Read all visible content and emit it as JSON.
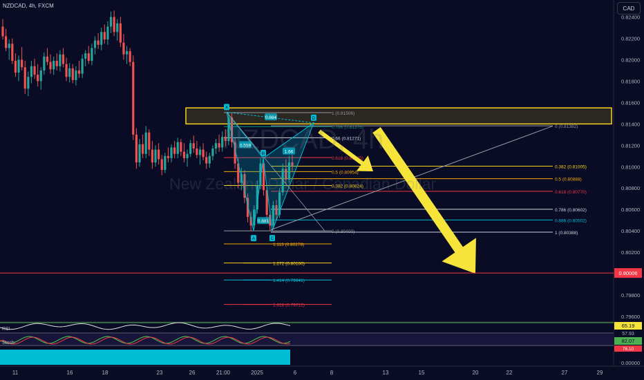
{
  "header": {
    "title": "NZDCAD, 4h, FXCM",
    "currency_button": "CAD"
  },
  "watermark": {
    "symbol": "NZDCAD, 4h",
    "description": "New Zealand Dollar / Canadian Dollar"
  },
  "colors": {
    "background": "#0a0c26",
    "up": "#26a69a",
    "down": "#ef5350",
    "zone": "#f7d21b",
    "arrow": "#f7e43a",
    "price_line": "#f23645"
  },
  "chart_data": {
    "type": "candlestick",
    "symbol": "NZDCAD",
    "interval": "4h",
    "ylim": [
      0.796,
      0.8252
    ],
    "yticks": [
      "0.82400",
      "0.82200",
      "0.82000",
      "0.81800",
      "0.81600",
      "0.81400",
      "0.81200",
      "0.81000",
      "0.80800",
      "0.80600",
      "0.80400",
      "0.80200",
      "0.80000",
      "0.79800",
      "0.79600"
    ],
    "xticks": [
      "11",
      "16",
      "18",
      "23",
      "26",
      "21:00",
      "2025",
      "6",
      "8",
      "13",
      "15",
      "20",
      "22",
      "27",
      "29"
    ],
    "current_price": {
      "value": 0.80006,
      "label": "0.80006"
    },
    "supply_zone": {
      "top": 0.8155,
      "bottom": 0.814
    },
    "fib_left": [
      {
        "ratio": "1",
        "value": 0.81506,
        "label": "1 (0.81506)",
        "color": "#9598a1"
      },
      {
        "ratio": "0.786",
        "value": 0.81375,
        "label": "0.786 (0.81375)",
        "color": "#089981"
      },
      {
        "ratio": "0.66",
        "value": 0.81271,
        "label": "0.66 (0.81271)",
        "color": "#d1d4dc"
      },
      {
        "ratio": "0.618",
        "value": 0.81085,
        "label": "0.618 (0.81085)",
        "color": "#f23645"
      },
      {
        "ratio": "0.5",
        "value": 0.80954,
        "label": "0.5 (0.80954)",
        "color": "#f7a700"
      },
      {
        "ratio": "0.382",
        "value": 0.80824,
        "label": "0.382 (0.80824)",
        "color": "#f7d21b"
      },
      {
        "ratio": "0",
        "value": 0.804,
        "label": "0 (0.80400)",
        "color": "#9598a1"
      },
      {
        "ratio": "1.113",
        "value": 0.80278,
        "label": "1.113 (0.80278)",
        "color": "#f7a700"
      },
      {
        "ratio": "1.272",
        "value": 0.801,
        "label": "1.272 (0.80100)",
        "color": "#f7d21b"
      },
      {
        "ratio": "1.414",
        "value": 0.79941,
        "label": "1.414 (0.79941)",
        "color": "#00bcd4"
      },
      {
        "ratio": "1.618",
        "value": 0.79712,
        "label": "1.618 (0.79712)",
        "color": "#f23645"
      }
    ],
    "fib_right": [
      {
        "ratio": "0",
        "value": 0.81382,
        "label": "0 (0.81382)",
        "color": "#9598a1"
      },
      {
        "ratio": "0.382",
        "value": 0.81005,
        "label": "0.382 (0.81005)",
        "color": "#f7d21b"
      },
      {
        "ratio": "0.5",
        "value": 0.80888,
        "label": "0.5 (0.80888)",
        "color": "#f7a700"
      },
      {
        "ratio": "0.618",
        "value": 0.8077,
        "label": "0.618 (0.80770)",
        "color": "#f23645"
      },
      {
        "ratio": "0.786",
        "value": 0.80602,
        "label": "0.786 (0.80602)",
        "color": "#d1d4dc"
      },
      {
        "ratio": "0.886",
        "value": 0.80502,
        "label": "0.886 (0.80502)",
        "color": "#00bcd4"
      },
      {
        "ratio": "1",
        "value": 0.80388,
        "label": "1 (0.80388)",
        "color": "#d1d4dc"
      }
    ],
    "pattern_labels": [
      "X",
      "A",
      "B",
      "C",
      "D"
    ],
    "pattern_ratios": [
      "0.884",
      "0.559",
      "1.66",
      "0.881"
    ],
    "candles": [
      {
        "o": 0.8231,
        "h": 0.8238,
        "l": 0.8219,
        "c": 0.8222
      },
      {
        "o": 0.8222,
        "h": 0.8229,
        "l": 0.8208,
        "c": 0.8211
      },
      {
        "o": 0.8211,
        "h": 0.8219,
        "l": 0.82,
        "c": 0.8215
      },
      {
        "o": 0.8215,
        "h": 0.822,
        "l": 0.8196,
        "c": 0.8199
      },
      {
        "o": 0.8199,
        "h": 0.8206,
        "l": 0.8184,
        "c": 0.8188
      },
      {
        "o": 0.8188,
        "h": 0.8204,
        "l": 0.818,
        "c": 0.82
      },
      {
        "o": 0.82,
        "h": 0.8212,
        "l": 0.819,
        "c": 0.8193
      },
      {
        "o": 0.8193,
        "h": 0.8199,
        "l": 0.8168,
        "c": 0.8173
      },
      {
        "o": 0.8173,
        "h": 0.8189,
        "l": 0.8166,
        "c": 0.8184
      },
      {
        "o": 0.8184,
        "h": 0.8199,
        "l": 0.8178,
        "c": 0.8194
      },
      {
        "o": 0.8194,
        "h": 0.8201,
        "l": 0.8182,
        "c": 0.8186
      },
      {
        "o": 0.8186,
        "h": 0.8196,
        "l": 0.8175,
        "c": 0.818
      },
      {
        "o": 0.818,
        "h": 0.8193,
        "l": 0.8172,
        "c": 0.819
      },
      {
        "o": 0.819,
        "h": 0.8207,
        "l": 0.8186,
        "c": 0.8203
      },
      {
        "o": 0.8203,
        "h": 0.8211,
        "l": 0.8195,
        "c": 0.8198
      },
      {
        "o": 0.8198,
        "h": 0.8205,
        "l": 0.8187,
        "c": 0.8191
      },
      {
        "o": 0.8191,
        "h": 0.8203,
        "l": 0.8186,
        "c": 0.8199
      },
      {
        "o": 0.8199,
        "h": 0.8206,
        "l": 0.819,
        "c": 0.8194
      },
      {
        "o": 0.8194,
        "h": 0.8209,
        "l": 0.8189,
        "c": 0.8205
      },
      {
        "o": 0.8205,
        "h": 0.8211,
        "l": 0.8193,
        "c": 0.8196
      },
      {
        "o": 0.8196,
        "h": 0.8202,
        "l": 0.818,
        "c": 0.8184
      },
      {
        "o": 0.8184,
        "h": 0.8197,
        "l": 0.8179,
        "c": 0.8192
      },
      {
        "o": 0.8192,
        "h": 0.8196,
        "l": 0.8178,
        "c": 0.8181
      },
      {
        "o": 0.8181,
        "h": 0.8194,
        "l": 0.8176,
        "c": 0.819
      },
      {
        "o": 0.819,
        "h": 0.8199,
        "l": 0.8183,
        "c": 0.8187
      },
      {
        "o": 0.8187,
        "h": 0.8205,
        "l": 0.8183,
        "c": 0.8201
      },
      {
        "o": 0.8201,
        "h": 0.8209,
        "l": 0.8194,
        "c": 0.8206
      },
      {
        "o": 0.8206,
        "h": 0.8213,
        "l": 0.8196,
        "c": 0.8199
      },
      {
        "o": 0.8199,
        "h": 0.8215,
        "l": 0.8195,
        "c": 0.8211
      },
      {
        "o": 0.8211,
        "h": 0.8222,
        "l": 0.8205,
        "c": 0.8218
      },
      {
        "o": 0.8218,
        "h": 0.8225,
        "l": 0.821,
        "c": 0.8214
      },
      {
        "o": 0.8214,
        "h": 0.823,
        "l": 0.8209,
        "c": 0.8226
      },
      {
        "o": 0.8226,
        "h": 0.8233,
        "l": 0.8215,
        "c": 0.8219
      },
      {
        "o": 0.8219,
        "h": 0.8236,
        "l": 0.8214,
        "c": 0.8231
      },
      {
        "o": 0.8231,
        "h": 0.8245,
        "l": 0.8225,
        "c": 0.824
      },
      {
        "o": 0.824,
        "h": 0.8246,
        "l": 0.8222,
        "c": 0.8226
      },
      {
        "o": 0.8226,
        "h": 0.8238,
        "l": 0.8218,
        "c": 0.8234
      },
      {
        "o": 0.8234,
        "h": 0.824,
        "l": 0.8212,
        "c": 0.8216
      },
      {
        "o": 0.8216,
        "h": 0.8224,
        "l": 0.82,
        "c": 0.8205
      },
      {
        "o": 0.8205,
        "h": 0.8213,
        "l": 0.8196,
        "c": 0.8208
      },
      {
        "o": 0.8208,
        "h": 0.8211,
        "l": 0.8194,
        "c": 0.8198
      },
      {
        "o": 0.8198,
        "h": 0.8204,
        "l": 0.8125,
        "c": 0.813
      },
      {
        "o": 0.813,
        "h": 0.8136,
        "l": 0.8098,
        "c": 0.8104
      },
      {
        "o": 0.8104,
        "h": 0.8126,
        "l": 0.81,
        "c": 0.8121
      },
      {
        "o": 0.8121,
        "h": 0.813,
        "l": 0.8108,
        "c": 0.8112
      },
      {
        "o": 0.8112,
        "h": 0.8138,
        "l": 0.8108,
        "c": 0.8132
      },
      {
        "o": 0.8132,
        "h": 0.8135,
        "l": 0.811,
        "c": 0.8116
      },
      {
        "o": 0.8116,
        "h": 0.8124,
        "l": 0.8098,
        "c": 0.8104
      },
      {
        "o": 0.8104,
        "h": 0.812,
        "l": 0.81,
        "c": 0.8116
      },
      {
        "o": 0.8116,
        "h": 0.8122,
        "l": 0.8102,
        "c": 0.8107
      },
      {
        "o": 0.8107,
        "h": 0.8111,
        "l": 0.8092,
        "c": 0.8097
      },
      {
        "o": 0.8097,
        "h": 0.8113,
        "l": 0.8094,
        "c": 0.811
      },
      {
        "o": 0.811,
        "h": 0.8118,
        "l": 0.8104,
        "c": 0.8108
      },
      {
        "o": 0.8108,
        "h": 0.8121,
        "l": 0.8104,
        "c": 0.8118
      },
      {
        "o": 0.8118,
        "h": 0.8124,
        "l": 0.8108,
        "c": 0.8112
      },
      {
        "o": 0.8112,
        "h": 0.8127,
        "l": 0.8108,
        "c": 0.8123
      },
      {
        "o": 0.8123,
        "h": 0.8126,
        "l": 0.811,
        "c": 0.8114
      },
      {
        "o": 0.8114,
        "h": 0.8122,
        "l": 0.8104,
        "c": 0.8108
      },
      {
        "o": 0.8108,
        "h": 0.8116,
        "l": 0.81,
        "c": 0.8112
      },
      {
        "o": 0.8112,
        "h": 0.8125,
        "l": 0.8109,
        "c": 0.8122
      },
      {
        "o": 0.8122,
        "h": 0.8129,
        "l": 0.8113,
        "c": 0.8117
      },
      {
        "o": 0.8117,
        "h": 0.8124,
        "l": 0.8108,
        "c": 0.8111
      },
      {
        "o": 0.8111,
        "h": 0.8119,
        "l": 0.8102,
        "c": 0.8116
      },
      {
        "o": 0.8116,
        "h": 0.8122,
        "l": 0.8106,
        "c": 0.8109
      },
      {
        "o": 0.8109,
        "h": 0.8114,
        "l": 0.8098,
        "c": 0.8103
      },
      {
        "o": 0.8103,
        "h": 0.8113,
        "l": 0.8099,
        "c": 0.811
      },
      {
        "o": 0.811,
        "h": 0.812,
        "l": 0.8106,
        "c": 0.8117
      },
      {
        "o": 0.8117,
        "h": 0.8126,
        "l": 0.8112,
        "c": 0.8122
      },
      {
        "o": 0.8122,
        "h": 0.813,
        "l": 0.8114,
        "c": 0.8118
      },
      {
        "o": 0.8118,
        "h": 0.8133,
        "l": 0.8114,
        "c": 0.8128
      },
      {
        "o": 0.8128,
        "h": 0.8135,
        "l": 0.8119,
        "c": 0.8124
      },
      {
        "o": 0.8124,
        "h": 0.8151,
        "l": 0.812,
        "c": 0.8146
      },
      {
        "o": 0.8146,
        "h": 0.815,
        "l": 0.8118,
        "c": 0.8123
      },
      {
        "o": 0.8123,
        "h": 0.8127,
        "l": 0.8098,
        "c": 0.8103
      },
      {
        "o": 0.8103,
        "h": 0.8108,
        "l": 0.808,
        "c": 0.8085
      },
      {
        "o": 0.8085,
        "h": 0.8099,
        "l": 0.8078,
        "c": 0.8093
      },
      {
        "o": 0.8093,
        "h": 0.8097,
        "l": 0.8066,
        "c": 0.8071
      },
      {
        "o": 0.8071,
        "h": 0.8075,
        "l": 0.8048,
        "c": 0.8053
      },
      {
        "o": 0.8053,
        "h": 0.8058,
        "l": 0.804,
        "c": 0.8045
      },
      {
        "o": 0.8045,
        "h": 0.8064,
        "l": 0.8042,
        "c": 0.806
      },
      {
        "o": 0.806,
        "h": 0.8087,
        "l": 0.8056,
        "c": 0.8082
      },
      {
        "o": 0.8082,
        "h": 0.8108,
        "l": 0.8079,
        "c": 0.8103
      },
      {
        "o": 0.8103,
        "h": 0.8106,
        "l": 0.8073,
        "c": 0.8078
      },
      {
        "o": 0.8078,
        "h": 0.8083,
        "l": 0.805,
        "c": 0.8055
      },
      {
        "o": 0.8055,
        "h": 0.8059,
        "l": 0.804,
        "c": 0.8045
      },
      {
        "o": 0.8045,
        "h": 0.8068,
        "l": 0.8042,
        "c": 0.8064
      },
      {
        "o": 0.8064,
        "h": 0.8069,
        "l": 0.805,
        "c": 0.8055
      },
      {
        "o": 0.8055,
        "h": 0.808,
        "l": 0.8052,
        "c": 0.8076
      },
      {
        "o": 0.8076,
        "h": 0.8103,
        "l": 0.8073,
        "c": 0.8098
      },
      {
        "o": 0.8098,
        "h": 0.8107,
        "l": 0.8084,
        "c": 0.8088
      },
      {
        "o": 0.8088,
        "h": 0.811,
        "l": 0.8085,
        "c": 0.8104
      },
      {
        "o": 0.8104,
        "h": 0.8111,
        "l": 0.8096,
        "c": 0.8101
      }
    ],
    "arrows": [
      {
        "from": [
          0.8139,
          0.8093
        ],
        "to": [
          0.8136,
          0.7995
        ],
        "style": "large"
      },
      {
        "from": [
          0.8141,
          0.8125
        ],
        "to": [
          0.8139,
          0.8102
        ],
        "style": "small"
      }
    ],
    "indicators": {
      "rsi": {
        "label": "RSI",
        "values": [
          "65.19",
          "57.93"
        ]
      },
      "stoch": {
        "label": "Stoch",
        "values": [
          "82.07",
          "76.10"
        ]
      },
      "bottom": {
        "value": "0.00000"
      }
    }
  }
}
